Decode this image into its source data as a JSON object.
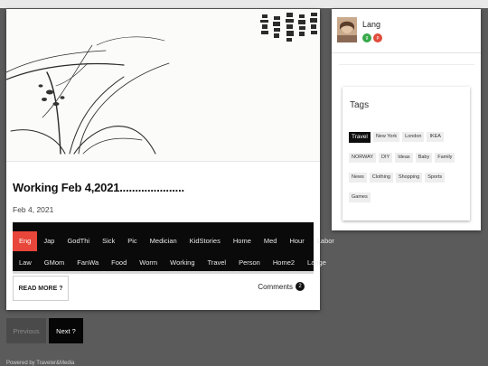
{
  "post": {
    "title": "Working Feb 4,2021.....................",
    "date": "Feb 4, 2021",
    "read_more": "READ MORE ?",
    "comments_label": "Comments",
    "comments_count": "2"
  },
  "category_bar": {
    "row1": [
      "Eng",
      "Jap",
      "GodThi",
      "Sick",
      "Pic",
      "Medician",
      "KidStories",
      "Home",
      "Med",
      "Hour",
      "Labor"
    ],
    "row2": [
      "Law",
      "GMom",
      "FanWa",
      "Food",
      "Worm",
      "Working",
      "Travel",
      "Person",
      "Home2",
      "Lange"
    ],
    "active": "Eng",
    "active_color": "#e8463a"
  },
  "pagination": {
    "previous": "Previous",
    "next": "Next ?"
  },
  "footer": {
    "powered_by": "Powered by Traveler&Media"
  },
  "sidebar": {
    "username": "Lang",
    "social_icons": [
      "google-plus-icon",
      "pinterest-icon"
    ],
    "tags_title": "Tags",
    "tags": [
      "Travel",
      "New York",
      "London",
      "IKEA",
      "NORWAY",
      "DIY",
      "Ideas",
      "Baby",
      "Family",
      "News",
      "Clothing",
      "Shopping",
      "Sports",
      "Games"
    ],
    "active_tag": "Travel"
  },
  "colors": {
    "background": "#5b5b5b",
    "accent": "#e8463a",
    "bar": "#0a0a0a"
  }
}
